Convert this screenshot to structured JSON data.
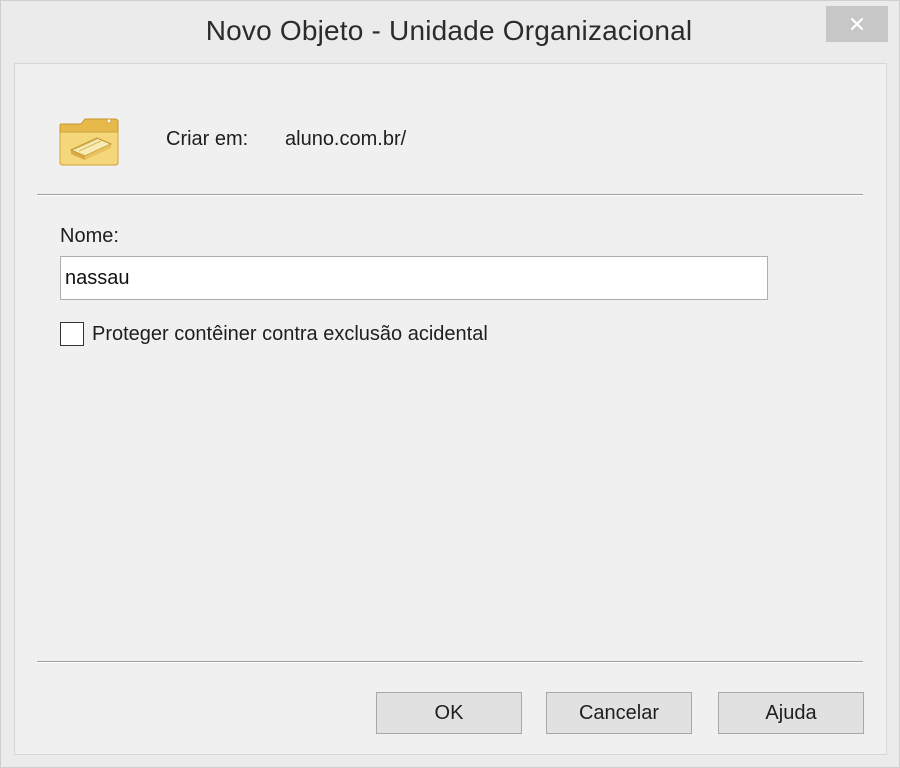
{
  "window": {
    "title": "Novo Objeto - Unidade Organizacional",
    "close_icon": "close-icon"
  },
  "header": {
    "icon": "organizational-unit-icon",
    "create_in_label": "Criar em:",
    "create_in_value": "aluno.com.br/"
  },
  "form": {
    "name_label": "Nome:",
    "name_value": "nassau",
    "protect_checkbox_label": "Proteger contêiner contra exclusão acidental",
    "protect_checked": false
  },
  "buttons": {
    "ok": "OK",
    "cancel": "Cancelar",
    "help": "Ajuda"
  },
  "colors": {
    "icon_yellow": "#f2cf63",
    "close_button_bg": "#c7c7c7"
  }
}
